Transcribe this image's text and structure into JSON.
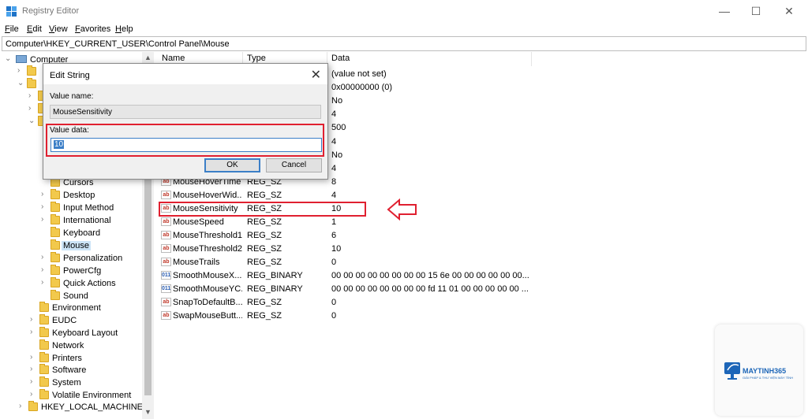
{
  "window": {
    "title": "Registry Editor",
    "controls": {
      "minimize": "—",
      "maximize": "☐",
      "close": "✕"
    }
  },
  "menu": [
    "File",
    "Edit",
    "View",
    "Favorites",
    "Help"
  ],
  "address": "Computer\\HKEY_CURRENT_USER\\Control Panel\\Mouse",
  "tree": {
    "root": "Computer",
    "items": [
      "Cursors",
      "Desktop",
      "Input Method",
      "International",
      "Keyboard",
      "Mouse",
      "Personalization",
      "PowerCfg",
      "Quick Actions",
      "Sound",
      "Environment",
      "EUDC",
      "Keyboard Layout",
      "Network",
      "Printers",
      "Software",
      "System",
      "Volatile Environment",
      "HKEY_LOCAL_MACHINE"
    ],
    "selected": "Mouse"
  },
  "columns": {
    "name": "Name",
    "type": "Type",
    "data": "Data"
  },
  "hidden_rows_data": [
    "(value not set)",
    "0x00000000 (0)",
    "No",
    "4",
    "500",
    "4",
    "No",
    "4"
  ],
  "values": [
    {
      "name": "MouseHoverTime",
      "type": "REG_SZ",
      "data": "8",
      "icon": "string-icon"
    },
    {
      "name": "MouseHoverWid...",
      "type": "REG_SZ",
      "data": "4",
      "icon": "string-icon"
    },
    {
      "name": "MouseSensitivity",
      "type": "REG_SZ",
      "data": "10",
      "icon": "string-icon"
    },
    {
      "name": "MouseSpeed",
      "type": "REG_SZ",
      "data": "1",
      "icon": "string-icon"
    },
    {
      "name": "MouseThreshold1",
      "type": "REG_SZ",
      "data": "6",
      "icon": "string-icon"
    },
    {
      "name": "MouseThreshold2",
      "type": "REG_SZ",
      "data": "10",
      "icon": "string-icon"
    },
    {
      "name": "MouseTrails",
      "type": "REG_SZ",
      "data": "0",
      "icon": "string-icon"
    },
    {
      "name": "SmoothMouseX...",
      "type": "REG_BINARY",
      "data": "00 00 00 00 00 00 00 00 15 6e 00 00 00 00 00 00...",
      "icon": "binary-icon"
    },
    {
      "name": "SmoothMouseYC...",
      "type": "REG_BINARY",
      "data": "00 00 00 00 00 00 00 00 fd 11 01 00 00 00 00 00 ...",
      "icon": "binary-icon"
    },
    {
      "name": "SnapToDefaultB...",
      "type": "REG_SZ",
      "data": "0",
      "icon": "string-icon"
    },
    {
      "name": "SwapMouseButt...",
      "type": "REG_SZ",
      "data": "0",
      "icon": "string-icon"
    }
  ],
  "dialog": {
    "title": "Edit String",
    "value_name_label": "Value name:",
    "value_name": "MouseSensitivity",
    "value_data_label": "Value data:",
    "value_data": "10",
    "ok": "OK",
    "cancel": "Cancel"
  },
  "logo": {
    "name": "MAYTINH365",
    "tagline": "GIẢI PHÁP & THƯ VIỆN MÁY TÍNH"
  },
  "colors": {
    "annotation": "#e02030",
    "selection": "#cce4f7",
    "accent": "#3c7fc7"
  }
}
